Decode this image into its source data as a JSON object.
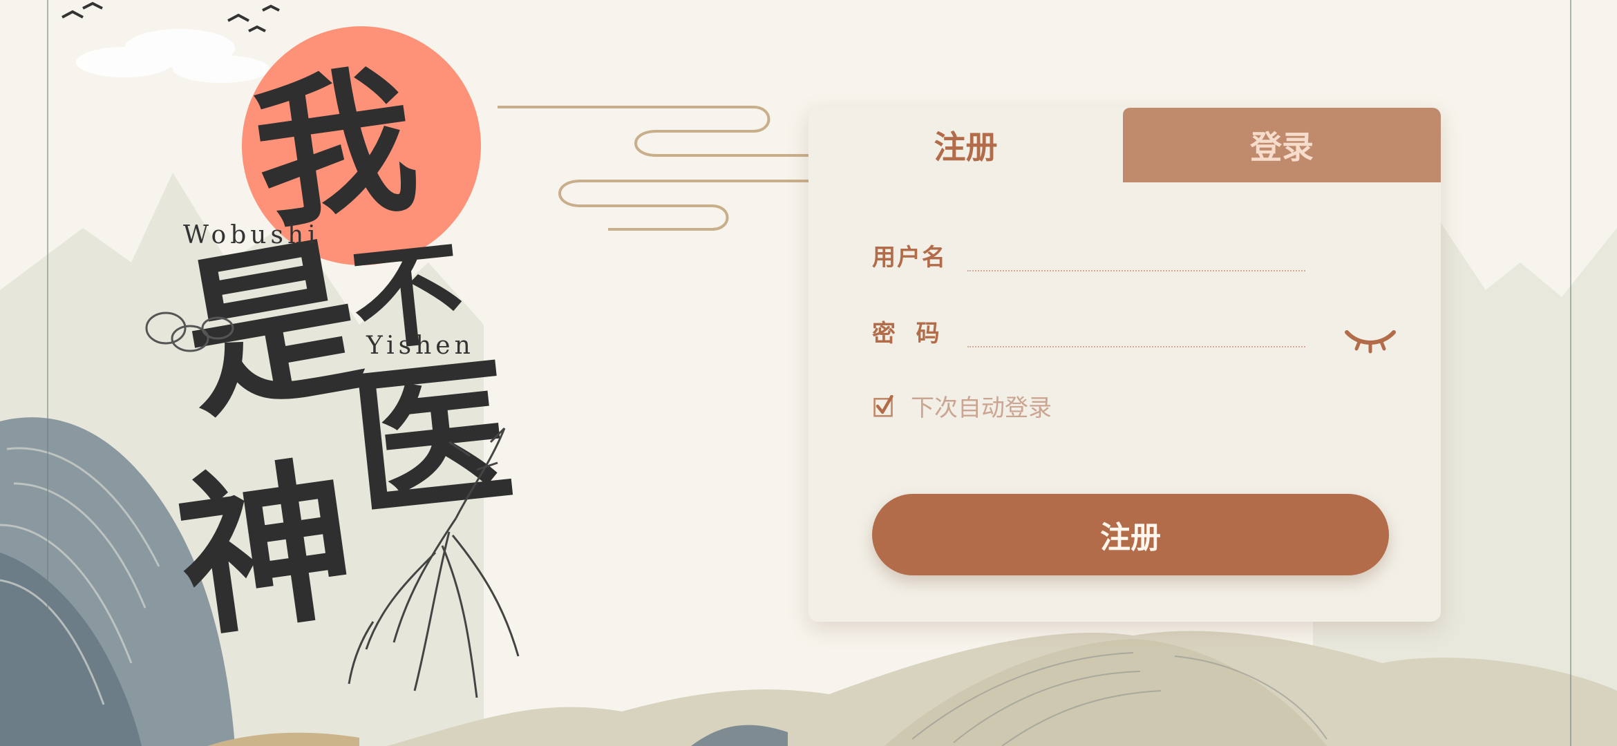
{
  "brand": {
    "chars": [
      "我",
      "不",
      "是",
      "医",
      "神"
    ],
    "latin_1": "Wobushi",
    "latin_2": "Yishen"
  },
  "tabs": {
    "register": "注册",
    "login": "登录",
    "active": "register"
  },
  "form": {
    "username_label": "用户名",
    "username_value": "",
    "password_label": "密  码",
    "password_value": "",
    "remember_label": "下次自动登录",
    "remember_checked": true,
    "submit_label": "注册"
  },
  "icons": {
    "password_toggle": "eye-closed-icon",
    "remember_check": "checkbox-checked-icon"
  },
  "colors": {
    "accent": "#b26c4a",
    "tab_inactive": "#c08a6c",
    "sun": "#fd9279",
    "background": "#f6f4ec",
    "card": "#f1efe6"
  }
}
